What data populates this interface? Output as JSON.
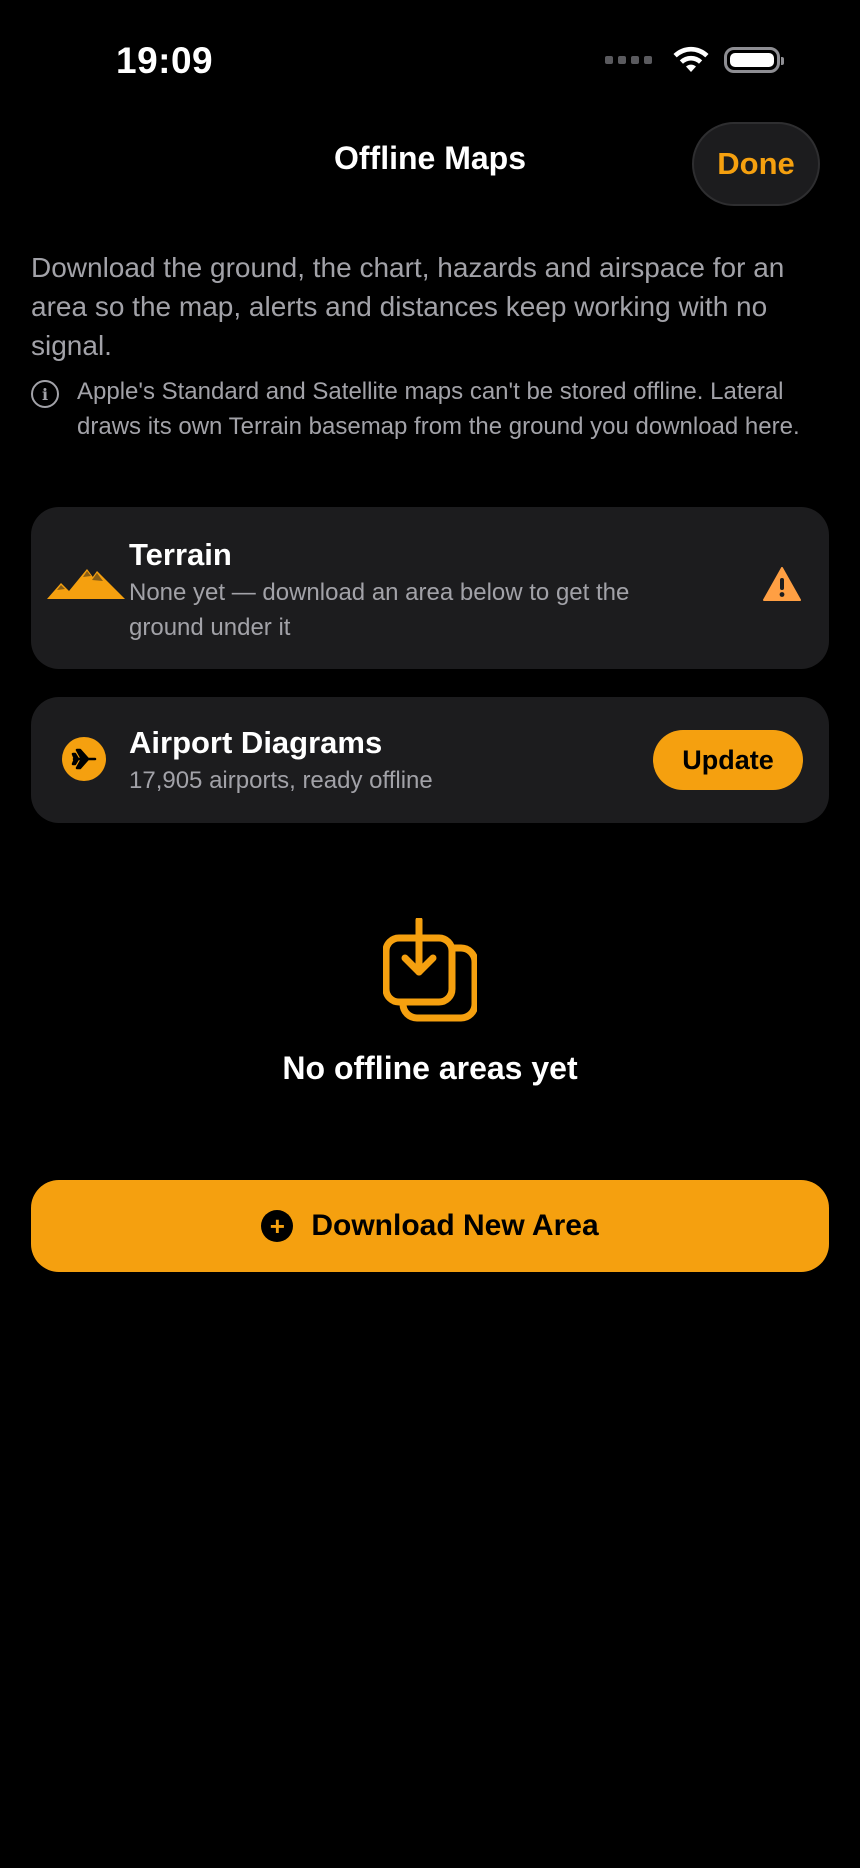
{
  "status_bar": {
    "time": "19:09"
  },
  "nav": {
    "title": "Offline Maps",
    "done_label": "Done"
  },
  "intro": {
    "description": "Download the ground, the chart, hazards and airspace for an area so the map, alerts and distances keep working with no signal.",
    "info": "Apple's Standard and Satellite maps can't be stored offline. Lateral draws its own Terrain basemap from the ground you download here."
  },
  "terrain_card": {
    "title": "Terrain",
    "subtitle": "None yet — download an area below to get the ground under it",
    "icon": "mountains-icon",
    "status_icon": "warning-icon"
  },
  "airport_card": {
    "title": "Airport Diagrams",
    "subtitle": "17,905 airports, ready offline",
    "icon": "airplane-icon",
    "update_label": "Update"
  },
  "empty_state": {
    "title": "No offline areas yet",
    "icon": "download-stack-icon"
  },
  "download_button": {
    "label": "Download New Area"
  },
  "colors": {
    "accent": "#f5a00f",
    "warning": "#ff9f43",
    "card_bg": "#1c1c1e",
    "secondary_text": "#a2a2a8"
  }
}
